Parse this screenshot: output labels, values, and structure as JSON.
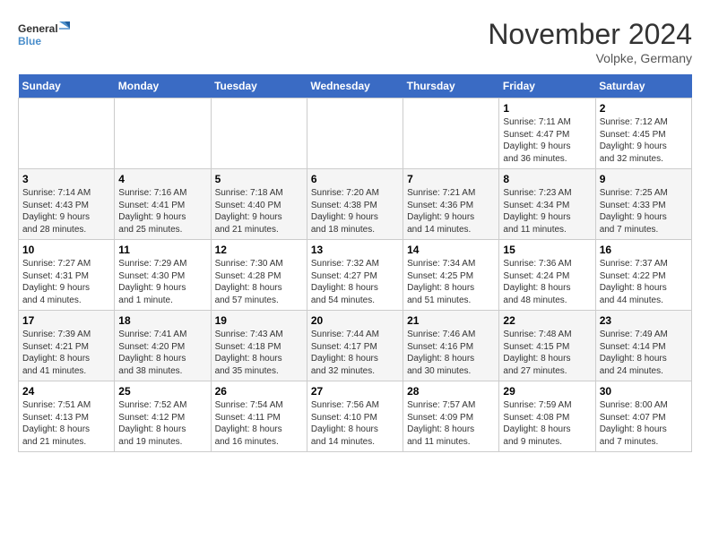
{
  "header": {
    "logo_line1": "General",
    "logo_line2": "Blue",
    "month": "November 2024",
    "location": "Volpke, Germany"
  },
  "days_of_week": [
    "Sunday",
    "Monday",
    "Tuesday",
    "Wednesday",
    "Thursday",
    "Friday",
    "Saturday"
  ],
  "weeks": [
    [
      {
        "day": "",
        "info": ""
      },
      {
        "day": "",
        "info": ""
      },
      {
        "day": "",
        "info": ""
      },
      {
        "day": "",
        "info": ""
      },
      {
        "day": "",
        "info": ""
      },
      {
        "day": "1",
        "info": "Sunrise: 7:11 AM\nSunset: 4:47 PM\nDaylight: 9 hours\nand 36 minutes."
      },
      {
        "day": "2",
        "info": "Sunrise: 7:12 AM\nSunset: 4:45 PM\nDaylight: 9 hours\nand 32 minutes."
      }
    ],
    [
      {
        "day": "3",
        "info": "Sunrise: 7:14 AM\nSunset: 4:43 PM\nDaylight: 9 hours\nand 28 minutes."
      },
      {
        "day": "4",
        "info": "Sunrise: 7:16 AM\nSunset: 4:41 PM\nDaylight: 9 hours\nand 25 minutes."
      },
      {
        "day": "5",
        "info": "Sunrise: 7:18 AM\nSunset: 4:40 PM\nDaylight: 9 hours\nand 21 minutes."
      },
      {
        "day": "6",
        "info": "Sunrise: 7:20 AM\nSunset: 4:38 PM\nDaylight: 9 hours\nand 18 minutes."
      },
      {
        "day": "7",
        "info": "Sunrise: 7:21 AM\nSunset: 4:36 PM\nDaylight: 9 hours\nand 14 minutes."
      },
      {
        "day": "8",
        "info": "Sunrise: 7:23 AM\nSunset: 4:34 PM\nDaylight: 9 hours\nand 11 minutes."
      },
      {
        "day": "9",
        "info": "Sunrise: 7:25 AM\nSunset: 4:33 PM\nDaylight: 9 hours\nand 7 minutes."
      }
    ],
    [
      {
        "day": "10",
        "info": "Sunrise: 7:27 AM\nSunset: 4:31 PM\nDaylight: 9 hours\nand 4 minutes."
      },
      {
        "day": "11",
        "info": "Sunrise: 7:29 AM\nSunset: 4:30 PM\nDaylight: 9 hours\nand 1 minute."
      },
      {
        "day": "12",
        "info": "Sunrise: 7:30 AM\nSunset: 4:28 PM\nDaylight: 8 hours\nand 57 minutes."
      },
      {
        "day": "13",
        "info": "Sunrise: 7:32 AM\nSunset: 4:27 PM\nDaylight: 8 hours\nand 54 minutes."
      },
      {
        "day": "14",
        "info": "Sunrise: 7:34 AM\nSunset: 4:25 PM\nDaylight: 8 hours\nand 51 minutes."
      },
      {
        "day": "15",
        "info": "Sunrise: 7:36 AM\nSunset: 4:24 PM\nDaylight: 8 hours\nand 48 minutes."
      },
      {
        "day": "16",
        "info": "Sunrise: 7:37 AM\nSunset: 4:22 PM\nDaylight: 8 hours\nand 44 minutes."
      }
    ],
    [
      {
        "day": "17",
        "info": "Sunrise: 7:39 AM\nSunset: 4:21 PM\nDaylight: 8 hours\nand 41 minutes."
      },
      {
        "day": "18",
        "info": "Sunrise: 7:41 AM\nSunset: 4:20 PM\nDaylight: 8 hours\nand 38 minutes."
      },
      {
        "day": "19",
        "info": "Sunrise: 7:43 AM\nSunset: 4:18 PM\nDaylight: 8 hours\nand 35 minutes."
      },
      {
        "day": "20",
        "info": "Sunrise: 7:44 AM\nSunset: 4:17 PM\nDaylight: 8 hours\nand 32 minutes."
      },
      {
        "day": "21",
        "info": "Sunrise: 7:46 AM\nSunset: 4:16 PM\nDaylight: 8 hours\nand 30 minutes."
      },
      {
        "day": "22",
        "info": "Sunrise: 7:48 AM\nSunset: 4:15 PM\nDaylight: 8 hours\nand 27 minutes."
      },
      {
        "day": "23",
        "info": "Sunrise: 7:49 AM\nSunset: 4:14 PM\nDaylight: 8 hours\nand 24 minutes."
      }
    ],
    [
      {
        "day": "24",
        "info": "Sunrise: 7:51 AM\nSunset: 4:13 PM\nDaylight: 8 hours\nand 21 minutes."
      },
      {
        "day": "25",
        "info": "Sunrise: 7:52 AM\nSunset: 4:12 PM\nDaylight: 8 hours\nand 19 minutes."
      },
      {
        "day": "26",
        "info": "Sunrise: 7:54 AM\nSunset: 4:11 PM\nDaylight: 8 hours\nand 16 minutes."
      },
      {
        "day": "27",
        "info": "Sunrise: 7:56 AM\nSunset: 4:10 PM\nDaylight: 8 hours\nand 14 minutes."
      },
      {
        "day": "28",
        "info": "Sunrise: 7:57 AM\nSunset: 4:09 PM\nDaylight: 8 hours\nand 11 minutes."
      },
      {
        "day": "29",
        "info": "Sunrise: 7:59 AM\nSunset: 4:08 PM\nDaylight: 8 hours\nand 9 minutes."
      },
      {
        "day": "30",
        "info": "Sunrise: 8:00 AM\nSunset: 4:07 PM\nDaylight: 8 hours\nand 7 minutes."
      }
    ]
  ]
}
